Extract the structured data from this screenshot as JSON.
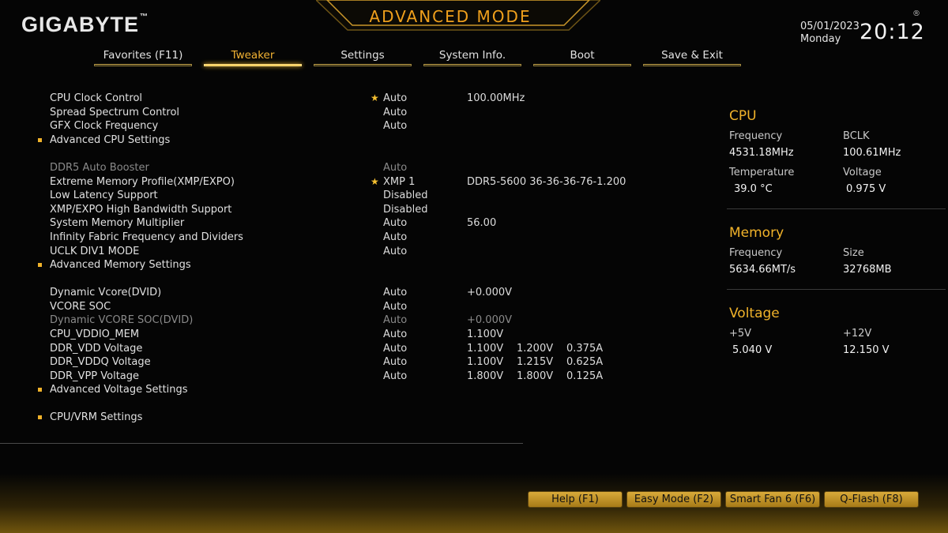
{
  "header": {
    "logo": "GIGABYTE",
    "logo_tm": "™",
    "mode_title": "ADVANCED MODE",
    "date": "05/01/2023",
    "weekday": "Monday",
    "time": "20:12",
    "reg_mark": "®"
  },
  "tabs": [
    {
      "label": "Favorites (F11)",
      "active": false
    },
    {
      "label": "Tweaker",
      "active": true
    },
    {
      "label": "Settings",
      "active": false
    },
    {
      "label": "System Info.",
      "active": false
    },
    {
      "label": "Boot",
      "active": false
    },
    {
      "label": "Save & Exit",
      "active": false
    }
  ],
  "settings": [
    {
      "label": "CPU Clock Control",
      "value": "Auto",
      "extra1": "100.00MHz",
      "star": true
    },
    {
      "label": "Spread Spectrum Control",
      "value": "Auto"
    },
    {
      "label": "GFX Clock Frequency",
      "value": "Auto"
    },
    {
      "label": "Advanced CPU Settings",
      "bullet": true
    },
    {
      "label": "DDR5 Auto Booster",
      "value": "Auto",
      "dim": true
    },
    {
      "label": "Extreme Memory Profile(XMP/EXPO)",
      "value": "XMP 1",
      "extra1": "DDR5-5600 36-36-36-76-1.200",
      "star": true
    },
    {
      "label": "Low Latency Support",
      "value": "Disabled"
    },
    {
      "label": "XMP/EXPO High Bandwidth Support",
      "value": "Disabled"
    },
    {
      "label": "System Memory Multiplier",
      "value": "Auto",
      "extra1": "56.00"
    },
    {
      "label": "Infinity Fabric Frequency and Dividers",
      "value": "Auto"
    },
    {
      "label": "UCLK DIV1 MODE",
      "value": "Auto"
    },
    {
      "label": "Advanced Memory Settings",
      "bullet": true
    },
    {
      "label": "Dynamic Vcore(DVID)",
      "value": "Auto",
      "extra1": "+0.000V"
    },
    {
      "label": "VCORE SOC",
      "value": "Auto"
    },
    {
      "label": "Dynamic VCORE SOC(DVID)",
      "value": "Auto",
      "extra1": "+0.000V",
      "dim": true
    },
    {
      "label": "CPU_VDDIO_MEM",
      "value": "Auto",
      "extra1": "1.100V"
    },
    {
      "label": "DDR_VDD Voltage",
      "value": "Auto",
      "extra1": "1.100V",
      "extra2": "1.200V",
      "extra3": "0.375A"
    },
    {
      "label": "DDR_VDDQ Voltage",
      "value": "Auto",
      "extra1": "1.100V",
      "extra2": "1.215V",
      "extra3": "0.625A"
    },
    {
      "label": "DDR_VPP Voltage",
      "value": "Auto",
      "extra1": "1.800V",
      "extra2": "1.800V",
      "extra3": "0.125A"
    },
    {
      "label": "Advanced Voltage Settings",
      "bullet": true
    },
    {
      "label": "CPU/VRM Settings",
      "bullet": true
    }
  ],
  "info": {
    "cpu": {
      "title": "CPU",
      "frequency_label": "Frequency",
      "frequency": "4531.18MHz",
      "bclk_label": "BCLK",
      "bclk": "100.61MHz",
      "temperature_label": "Temperature",
      "temperature": "39.0 °C",
      "voltage_label": "Voltage",
      "voltage": "0.975 V"
    },
    "memory": {
      "title": "Memory",
      "frequency_label": "Frequency",
      "frequency": "5634.66MT/s",
      "size_label": "Size",
      "size": "32768MB"
    },
    "voltage": {
      "title": "Voltage",
      "v5_label": "+5V",
      "v5": "5.040 V",
      "v12_label": "+12V",
      "v12": "12.150 V"
    }
  },
  "footer_buttons": [
    "Help (F1)",
    "Easy Mode (F2)",
    "Smart Fan 6 (F6)",
    "Q-Flash (F8)"
  ],
  "colors": {
    "accent": "#f0b22a",
    "background": "#050505",
    "button": "#c9992b"
  }
}
